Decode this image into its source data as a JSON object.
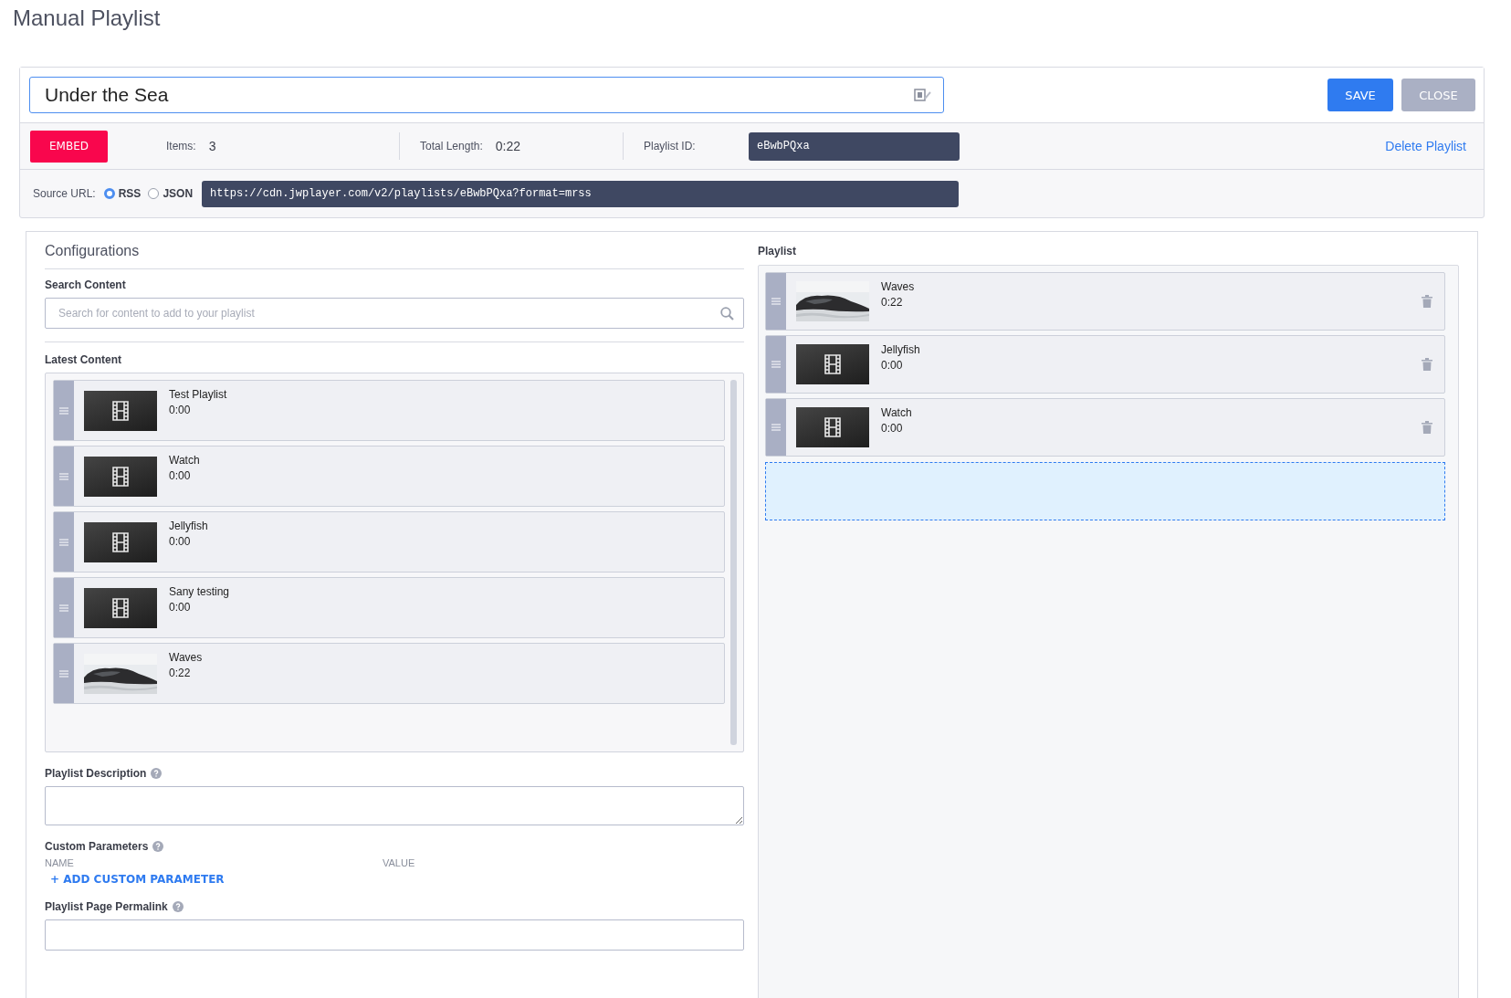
{
  "page_title": "Manual Playlist",
  "title_field": {
    "value": "Under the Sea"
  },
  "buttons": [
    {
      "label": "SAVE",
      "kind": "primary"
    },
    {
      "label": "CLOSE",
      "kind": "secondary"
    }
  ],
  "embed_button": "EMBED",
  "stats": [
    {
      "label": "Items:",
      "value": "3"
    },
    {
      "label": "Total Length:",
      "value": "0:22"
    }
  ],
  "playlist_id": {
    "label": "Playlist ID:",
    "value": "eBwbPQxa"
  },
  "delete_link": "Delete Playlist",
  "source": {
    "label": "Source URL:",
    "options": [
      {
        "label": "RSS",
        "selected": true
      },
      {
        "label": "JSON",
        "selected": false
      }
    ],
    "url": "https://cdn.jwplayer.com/v2/playlists/eBwbPQxa?format=mrss"
  },
  "configurations": {
    "title": "Configurations",
    "search": {
      "label": "Search Content",
      "placeholder": "Search for content to add to your playlist"
    },
    "latest": {
      "label": "Latest Content",
      "items": [
        {
          "title": "Test Playlist",
          "duration": "0:00",
          "kind": "film"
        },
        {
          "title": "Watch",
          "duration": "0:00",
          "kind": "film"
        },
        {
          "title": "Jellyfish",
          "duration": "0:00",
          "kind": "film"
        },
        {
          "title": "Sany testing",
          "duration": "0:00",
          "kind": "film"
        },
        {
          "title": "Waves",
          "duration": "0:22",
          "kind": "picture"
        }
      ]
    },
    "description": {
      "label": "Playlist Description"
    },
    "custom_parameters": {
      "label": "Custom Parameters",
      "columns": [
        "NAME",
        "VALUE"
      ],
      "add_link": "+ ADD CUSTOM PARAMETER"
    },
    "permalink": {
      "label": "Playlist Page Permalink"
    }
  },
  "playlist": {
    "title": "Playlist",
    "items": [
      {
        "title": "Waves",
        "duration": "0:22",
        "kind": "picture"
      },
      {
        "title": "Jellyfish",
        "duration": "0:00",
        "kind": "film"
      },
      {
        "title": "Watch",
        "duration": "0:00",
        "kind": "film"
      }
    ]
  }
}
